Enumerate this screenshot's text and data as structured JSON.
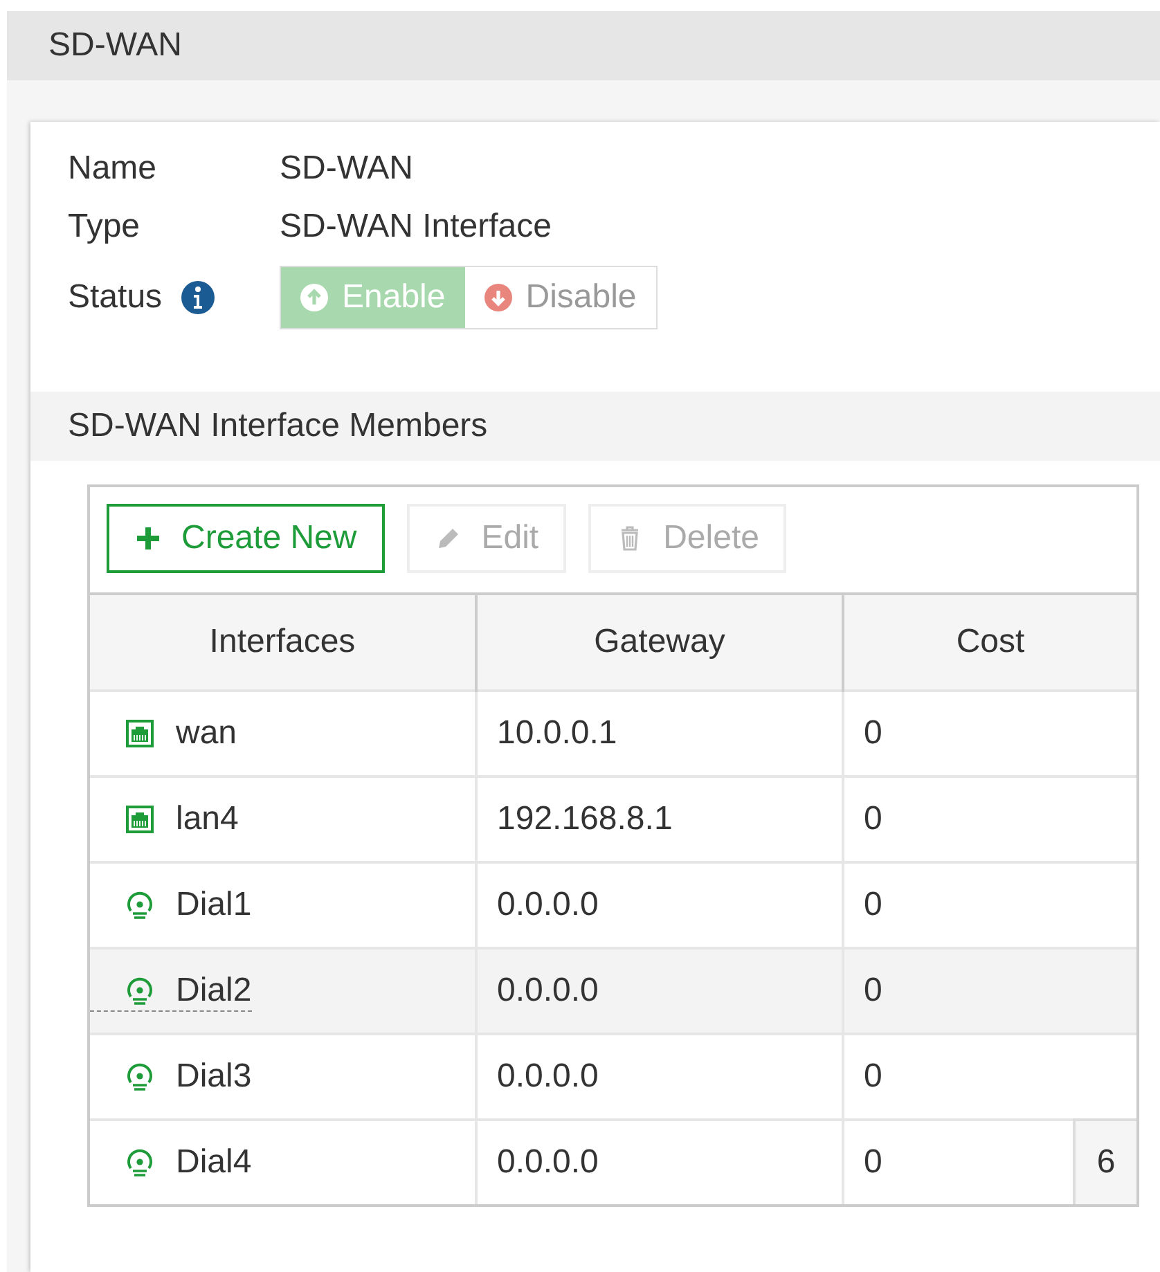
{
  "header": {
    "title": "SD-WAN"
  },
  "fields": [
    {
      "label": "Name",
      "value": "SD-WAN"
    },
    {
      "label": "Type",
      "value": "SD-WAN Interface"
    }
  ],
  "status": {
    "label": "Status",
    "options": [
      {
        "label": "Enable",
        "kind": "up",
        "selected": true
      },
      {
        "label": "Disable",
        "kind": "down",
        "selected": false
      }
    ]
  },
  "members": {
    "title": "SD-WAN Interface Members",
    "toolbar": [
      {
        "label": "Create New",
        "kind": "plus",
        "disabled": false
      },
      {
        "label": "Edit",
        "kind": "pencil",
        "disabled": true
      },
      {
        "label": "Delete",
        "kind": "trash",
        "disabled": true
      }
    ],
    "columns": [
      "Interfaces",
      "Gateway",
      "Cost"
    ],
    "rows": [
      {
        "interface": "wan",
        "kind": "physical",
        "gateway": "10.0.0.1",
        "cost": "0",
        "hovered": false
      },
      {
        "interface": "lan4",
        "kind": "physical",
        "gateway": "192.168.8.1",
        "cost": "0",
        "hovered": false
      },
      {
        "interface": "Dial1",
        "kind": "dialup",
        "gateway": "0.0.0.0",
        "cost": "0",
        "hovered": false
      },
      {
        "interface": "Dial2",
        "kind": "dialup",
        "gateway": "0.0.0.0",
        "cost": "0",
        "hovered": true
      },
      {
        "interface": "Dial3",
        "kind": "dialup",
        "gateway": "0.0.0.0",
        "cost": "0",
        "hovered": false
      },
      {
        "interface": "Dial4",
        "kind": "dialup",
        "gateway": "0.0.0.0",
        "cost": "0",
        "hovered": false
      }
    ],
    "count": "6"
  }
}
